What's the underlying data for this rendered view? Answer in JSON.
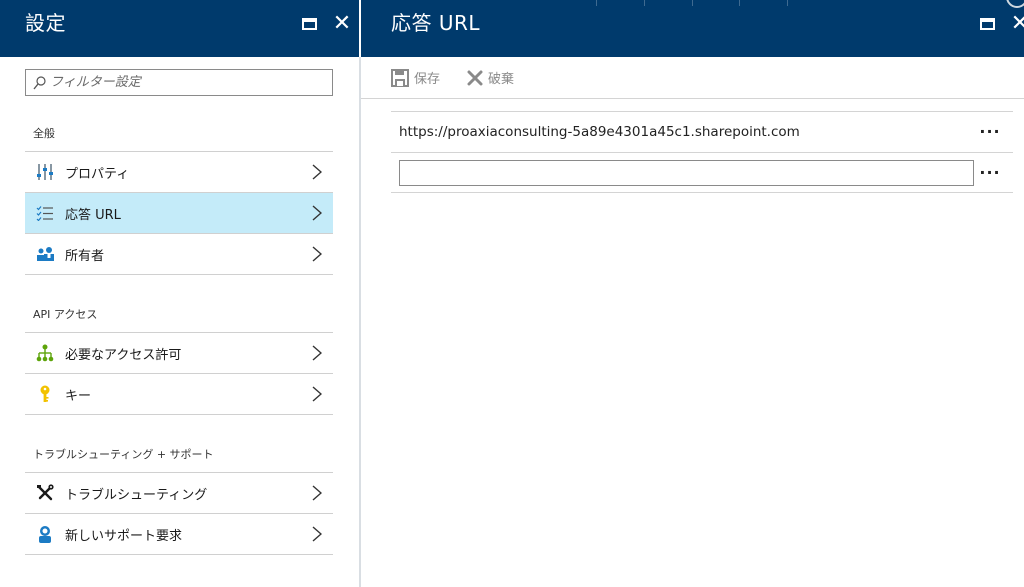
{
  "left_blade": {
    "title": "設定",
    "filter": {
      "placeholder": "フィルター設定",
      "value": ""
    },
    "sections": [
      {
        "title": "全般",
        "items": [
          {
            "label": "プロパティ",
            "icon": "sliders-icon",
            "selected": false
          },
          {
            "label": "応答 URL",
            "icon": "list-icon",
            "selected": true
          },
          {
            "label": "所有者",
            "icon": "owners-icon",
            "selected": false
          }
        ]
      },
      {
        "title": "API アクセス",
        "items": [
          {
            "label": "必要なアクセス許可",
            "icon": "hierarchy-icon",
            "selected": false
          },
          {
            "label": "キー",
            "icon": "key-icon",
            "selected": false
          }
        ]
      },
      {
        "title": "トラブルシューティング + サポート",
        "items": [
          {
            "label": "トラブルシューティング",
            "icon": "wrench-screwdriver-icon",
            "selected": false
          },
          {
            "label": "新しいサポート要求",
            "icon": "support-person-icon",
            "selected": false
          }
        ]
      }
    ]
  },
  "right_blade": {
    "title": "応答 URL",
    "toolbar": {
      "save_label": "保存",
      "discard_label": "破棄"
    },
    "reply_urls": [
      {
        "value": "https://proaxiaconsulting-5a89e4301a45c1.sharepoint.com"
      }
    ],
    "new_url": {
      "value": "",
      "placeholder": ""
    }
  },
  "colors": {
    "header_bg": "#003a6c",
    "selected_bg": "#c4ebf9",
    "key_icon": "#f2c200",
    "hierarchy_icon": "#5ea40b",
    "person_icon": "#1c7bc4"
  }
}
